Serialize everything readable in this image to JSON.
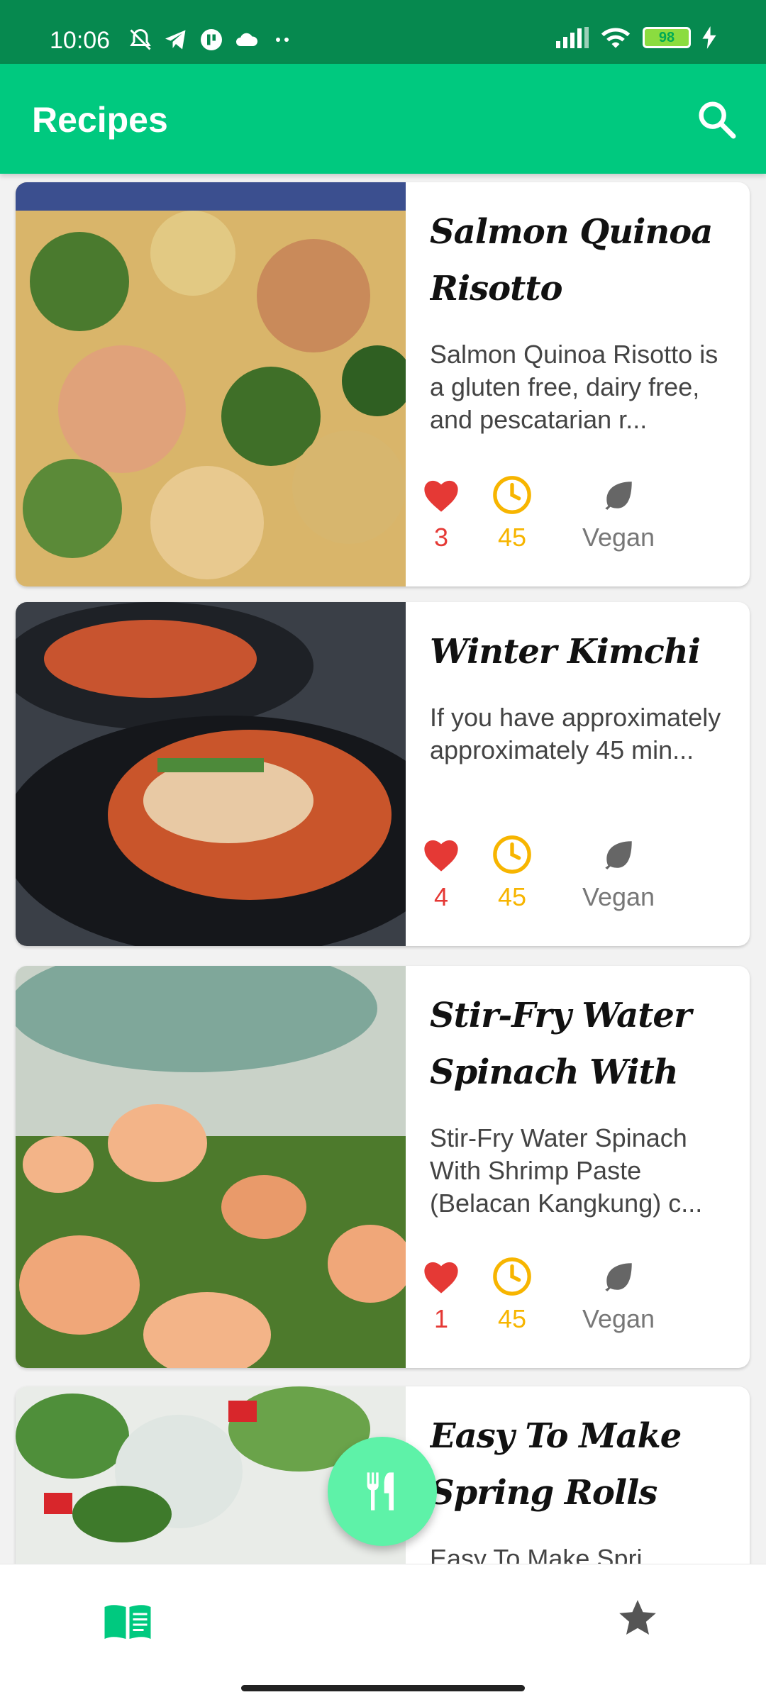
{
  "status_bar": {
    "time": "10:06",
    "battery": "98",
    "icons": [
      "muted-bell-icon",
      "telegram-icon",
      "app-icon",
      "cloud-icon",
      "more-dots-icon",
      "signal-icon",
      "wifi-icon",
      "battery-icon",
      "charging-icon"
    ]
  },
  "app_bar": {
    "title": "Recipes",
    "search_icon": "search-icon"
  },
  "recipes": [
    {
      "title": "Salmon Quinoa Risotto",
      "description": "Salmon Quinoa Risotto is a gluten free, dairy free, and pescatarian r...",
      "likes": "3",
      "minutes": "45",
      "tag": "Vegan"
    },
    {
      "title": "Winter Kimchi",
      "description": "If you have approximately approximately 45 min...",
      "likes": "4",
      "minutes": "45",
      "tag": "Vegan"
    },
    {
      "title": "Stir-Fry Water Spinach With Shri...",
      "description": "Stir-Fry Water Spinach With Shrimp Paste (Belacan Kangkung) c...",
      "likes": "1",
      "minutes": "45",
      "tag": "Vegan"
    },
    {
      "title": "Easy To Make Spring Rolls",
      "description": "Easy To Make Spri..."
    }
  ],
  "fab": {
    "icon": "fork-knife-icon"
  },
  "bottom_nav": {
    "items": [
      {
        "icon": "book-icon",
        "active": true,
        "color": "#00c97f"
      },
      {
        "icon": "star-icon",
        "active": false,
        "color": "#555555"
      }
    ]
  },
  "colors": {
    "status_bar": "#06894f",
    "app_bar": "#00c97f",
    "fab": "#5ef2a8",
    "like": "#e53935",
    "time": "#f7b500",
    "vegan": "#777777"
  }
}
